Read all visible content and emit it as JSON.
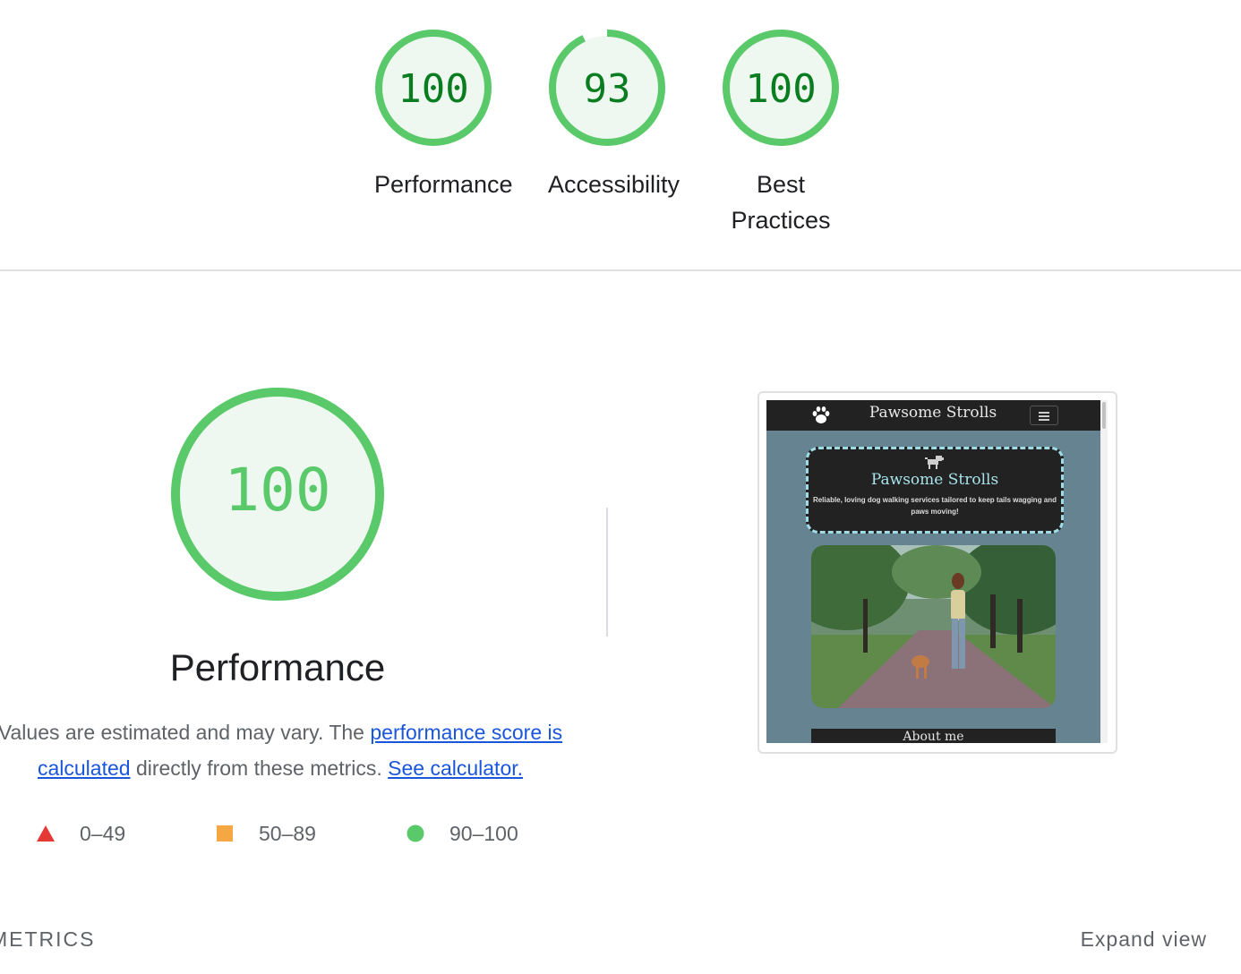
{
  "gauges": [
    {
      "label": "Performance",
      "score": "100",
      "fraction": 1.0
    },
    {
      "label": "Accessibility",
      "score": "93",
      "fraction": 0.93
    },
    {
      "label": "Best Practices",
      "score": "100",
      "fraction": 1.0
    }
  ],
  "performance": {
    "score": "100",
    "fraction": 1.0,
    "title": "Performance",
    "desc_prefix": "Values are estimated and may vary. The ",
    "score_link": "performance score is calculated",
    "desc_middle": " directly from these metrics. ",
    "calc_link": "See calculator."
  },
  "legend": [
    {
      "icon": "triangle-icon",
      "range": "0–49",
      "color": "#e53935"
    },
    {
      "icon": "square-icon",
      "range": "50–89",
      "color": "#f4a742"
    },
    {
      "icon": "circle-icon",
      "range": "90–100",
      "color": "#5ac96a"
    }
  ],
  "colors": {
    "pass_ring": "#5ac96a",
    "pass_fill": "#eef8f0",
    "pass_text": "#0a7d20",
    "link": "#1a56db"
  },
  "screenshot": {
    "nav_title": "Pawsome Strolls",
    "hero_title": "Pawsome Strolls",
    "hero_sub": "Reliable, loving dog walking services tailored to keep tails wagging and paws moving!",
    "about": "About me"
  },
  "metrics": {
    "label": "METRICS",
    "expand": "Expand view"
  }
}
